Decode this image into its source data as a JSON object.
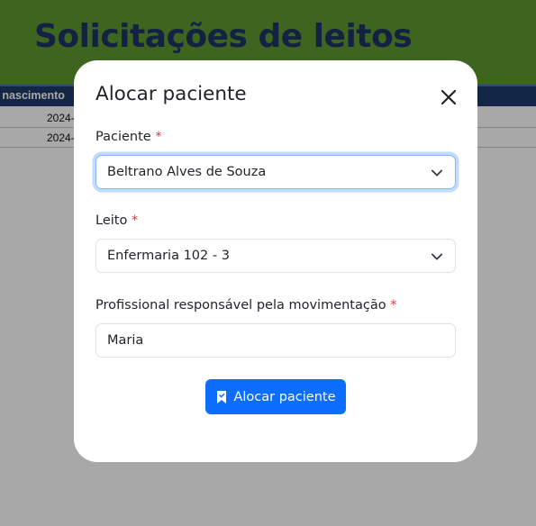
{
  "page": {
    "title": "Solicitações de leitos",
    "table": {
      "header_visible": "e nascimento",
      "rows": [
        "2024-",
        "2024-"
      ]
    }
  },
  "modal": {
    "title": "Alocar paciente",
    "close_icon": "close-icon",
    "fields": {
      "paciente": {
        "label": "Paciente",
        "required_mark": "*",
        "value": "Beltrano Alves de Souza"
      },
      "leito": {
        "label": "Leito",
        "required_mark": "*",
        "value": "Enfermaria 102 - 3"
      },
      "profissional": {
        "label": "Profissional responsável pela movimentação",
        "required_mark": "*",
        "value": "Maria"
      }
    },
    "submit": {
      "label": "Alocar paciente",
      "icon": "bookmark-icon"
    }
  },
  "colors": {
    "header_green": "#5e9a30",
    "title_navy": "#1d3566",
    "table_header": "#1e3a6b",
    "primary": "#0d6efd",
    "required": "#dc3545"
  }
}
